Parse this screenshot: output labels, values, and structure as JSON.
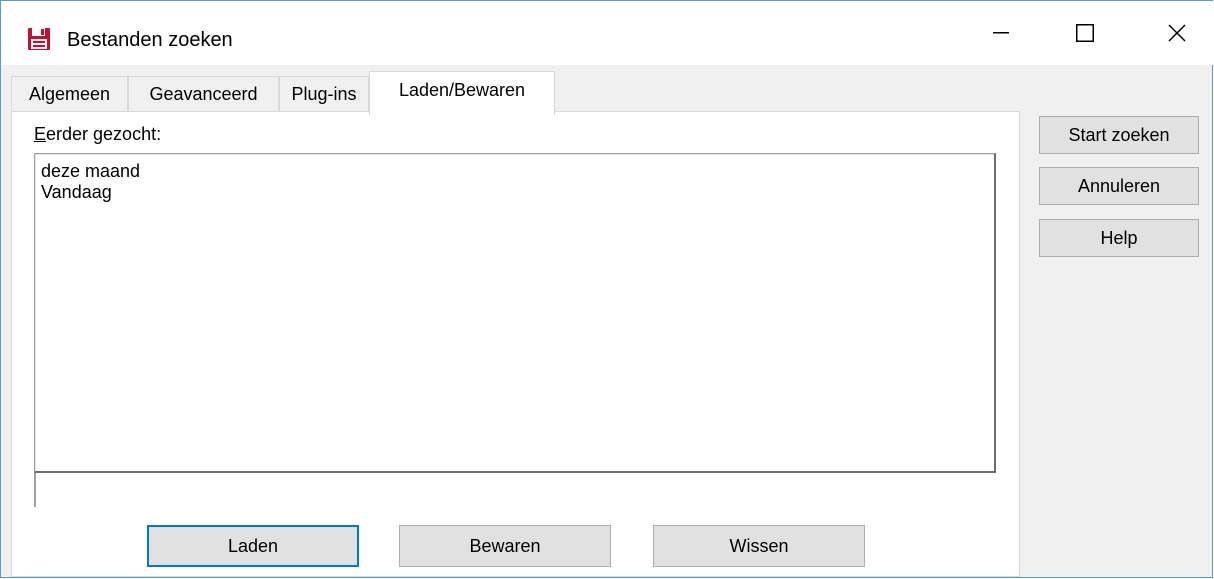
{
  "window": {
    "title": "Bestanden zoeken",
    "controls": {
      "minimize": "minimize-icon",
      "maximize": "maximize-icon",
      "close": "close-icon"
    }
  },
  "tabs": [
    {
      "label": "Algemeen",
      "active": false
    },
    {
      "label": "Geavanceerd",
      "active": false
    },
    {
      "label": "Plug-ins",
      "active": false
    },
    {
      "label": "Laden/Bewaren",
      "active": true
    }
  ],
  "panel": {
    "label_accel": "E",
    "label_rest": "erder gezocht:",
    "items": [
      "deze maand",
      "Vandaag"
    ]
  },
  "buttons": {
    "load": "Laden",
    "save": "Bewaren",
    "clear": "Wissen"
  },
  "side_buttons": {
    "start": "Start zoeken",
    "cancel": "Annuleren",
    "help": "Help"
  },
  "colors": {
    "accent": "#0078d7",
    "icon_red": "#c8102e",
    "window_border": "#5a9bd5"
  }
}
